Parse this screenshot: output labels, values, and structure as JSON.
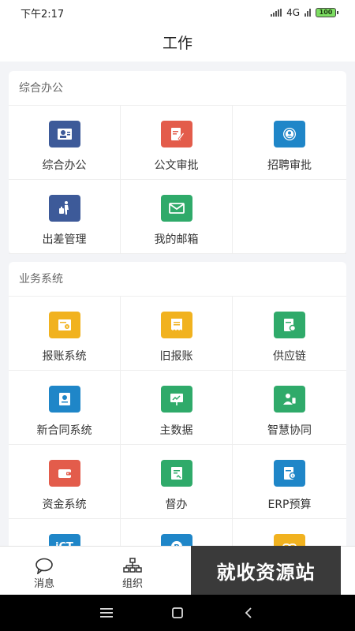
{
  "status": {
    "time": "下午2:17",
    "network": "4G",
    "battery": "100"
  },
  "page": {
    "title": "工作"
  },
  "sections": [
    {
      "title": "综合办公",
      "apps": [
        {
          "label": "综合办公",
          "icon": "badge-icon",
          "color": "#3d5a99"
        },
        {
          "label": "公文审批",
          "icon": "document-edit-icon",
          "color": "#e35c4b"
        },
        {
          "label": "招聘审批",
          "icon": "recruit-icon",
          "color": "#1f86c8"
        },
        {
          "label": "出差管理",
          "icon": "business-trip-icon",
          "color": "#3d5a99"
        },
        {
          "label": "我的邮箱",
          "icon": "mail-icon",
          "color": "#2faa6a"
        }
      ]
    },
    {
      "title": "业务系统",
      "apps": [
        {
          "label": "报账系统",
          "icon": "reimburse-icon",
          "color": "#f1b21f"
        },
        {
          "label": "旧报账",
          "icon": "receipt-icon",
          "color": "#f1b21f"
        },
        {
          "label": "供应链",
          "icon": "supply-chain-icon",
          "color": "#2faa6a"
        },
        {
          "label": "新合同系统",
          "icon": "contract-icon",
          "color": "#1f86c8"
        },
        {
          "label": "主数据",
          "icon": "presentation-icon",
          "color": "#2faa6a"
        },
        {
          "label": "智慧协同",
          "icon": "collaboration-icon",
          "color": "#2faa6a"
        },
        {
          "label": "资金系统",
          "icon": "wallet-icon",
          "color": "#e35c4b"
        },
        {
          "label": "督办",
          "icon": "supervise-icon",
          "color": "#2faa6a"
        },
        {
          "label": "ERP预算",
          "icon": "budget-icon",
          "color": "#1f86c8"
        },
        {
          "label": "",
          "icon": "ict-icon",
          "color": "#1f86c8",
          "icon_text": "iCT"
        },
        {
          "label": "",
          "icon": "circle-app-icon",
          "color": "#1f86c8"
        },
        {
          "label": "",
          "icon": "link-app-icon",
          "color": "#f1b21f"
        }
      ]
    }
  ],
  "bottom_nav": [
    {
      "label": "消息",
      "icon": "message-icon"
    },
    {
      "label": "组织",
      "icon": "organization-icon"
    }
  ],
  "watermark": {
    "text": "就收资源站"
  }
}
